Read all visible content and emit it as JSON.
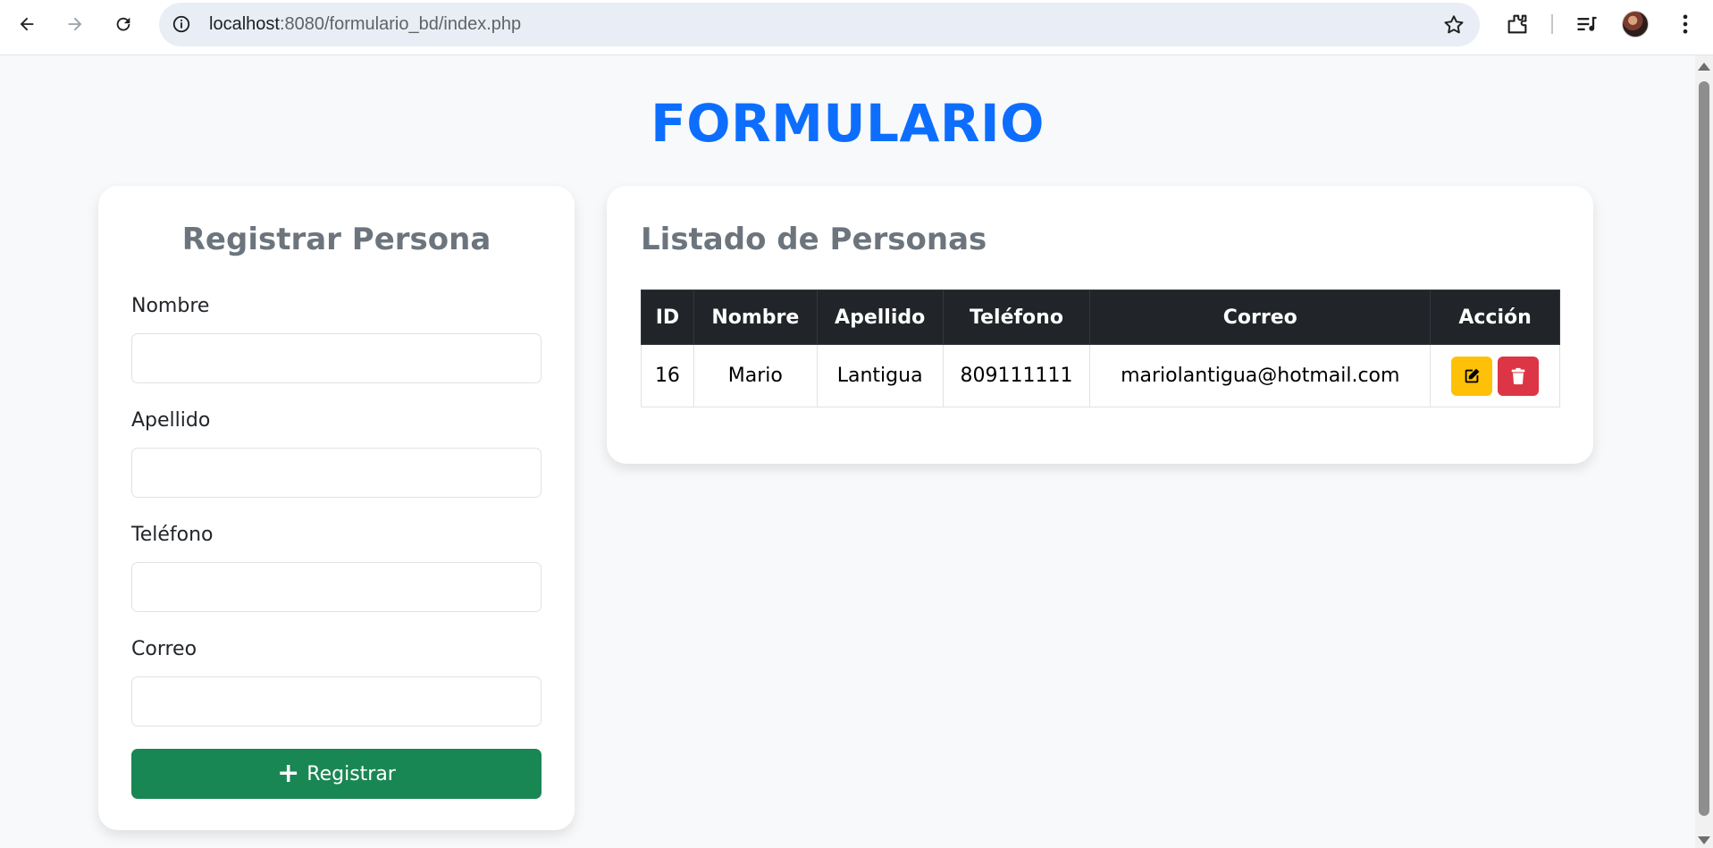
{
  "browser": {
    "url_host": "localhost",
    "url_rest": ":8080/formulario_bd/index.php"
  },
  "page": {
    "title": "FORMULARIO"
  },
  "form": {
    "title": "Registrar Persona",
    "fields": [
      {
        "label": "Nombre",
        "value": ""
      },
      {
        "label": "Apellido",
        "value": ""
      },
      {
        "label": "Teléfono",
        "value": ""
      },
      {
        "label": "Correo",
        "value": ""
      }
    ],
    "submit_label": "Registrar"
  },
  "list": {
    "title": "Listado de Personas",
    "columns": [
      "ID",
      "Nombre",
      "Apellido",
      "Teléfono",
      "Correo",
      "Acción"
    ],
    "rows": [
      {
        "id": "16",
        "nombre": "Mario",
        "apellido": "Lantigua",
        "telefono": "809111111",
        "correo": "mariolantigua@hotmail.com"
      }
    ]
  },
  "colors": {
    "primary": "#0d6efd",
    "success": "#198754",
    "warning": "#ffc107",
    "danger": "#dc3545",
    "dark": "#212529"
  }
}
